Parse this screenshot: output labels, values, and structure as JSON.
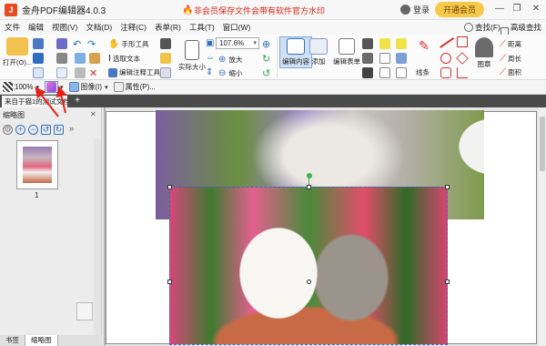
{
  "titlebar": {
    "app_title": "金舟PDF编辑器4.0.3",
    "promo_text": "非会员保存文件会带有软件官方水印",
    "login_label": "登录",
    "vip_label": "开通会员",
    "controls": [
      "minimize-icon",
      "restore-icon",
      "close-icon"
    ]
  },
  "menu": {
    "items": [
      "文件",
      "编辑",
      "视图(V)",
      "文档(D)",
      "注释(C)",
      "表单(R)",
      "工具(T)",
      "窗口(W)"
    ],
    "find_label": "查找(F)",
    "advanced_find_label": "高级查找(S)"
  },
  "ribbon": {
    "open_label": "打开(O)...",
    "hand_tool": "手形工具",
    "select_text": "选取文本",
    "edit_annot_tool": "编辑注释工具",
    "actual_size": "实际大小",
    "zoom_value": "107.6%",
    "zoom_in": "放大",
    "zoom_out": "缩小",
    "edit_content": "编辑内容",
    "add_label": "添加",
    "edit_form": "编辑表单",
    "line_label": "线条",
    "stamp_label": "图章",
    "distance_label": "距离",
    "perimeter_label": "周长",
    "area_label": "面积"
  },
  "toolbar2": {
    "zoom_value": "100%",
    "image_label": "图像(I)",
    "properties_label": "属性(P)..."
  },
  "tabs": {
    "doc_tab_label": "来自于猫1的测试文档"
  },
  "sidebar": {
    "title": "缩略图",
    "page_number": "1"
  },
  "bottom_tabs": [
    "书签",
    "缩略图"
  ],
  "colors": {
    "accent_red": "#d9261c",
    "vip_gold": "#f7c94b",
    "selection_blue": "#3a64c8",
    "tab_bar": "#4a4a4a"
  }
}
